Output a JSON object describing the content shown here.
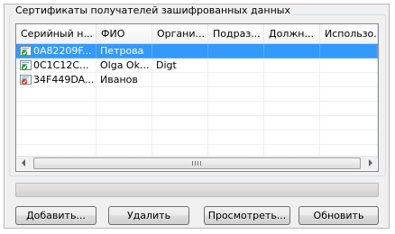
{
  "group": {
    "title": "Сертификаты получателей зашифрованных данных"
  },
  "table": {
    "columns": [
      "Серийный н...",
      "ФИО",
      "Органи...",
      "Подраз...",
      "Должн...",
      "Использо..."
    ],
    "rows": [
      {
        "serial": "0A82209F...",
        "name": "Петрова",
        "org": "",
        "dept": "",
        "position": "",
        "usage": "",
        "icon": "certificate-valid-icon",
        "selected": true
      },
      {
        "serial": "0C1C12C...",
        "name": "Olga Ok...",
        "org": "Digt",
        "dept": "",
        "position": "",
        "usage": "",
        "icon": "certificate-valid-icon",
        "selected": false
      },
      {
        "serial": "34F449DA...",
        "name": "Иванов",
        "org": "",
        "dept": "",
        "position": "",
        "usage": "",
        "icon": "certificate-warning-icon",
        "selected": false
      }
    ]
  },
  "buttons": {
    "add": "Добавить...",
    "delete": "Удалить",
    "view": "Просмотреть...",
    "refresh": "Обновить"
  },
  "colors": {
    "selection": "#3399ff",
    "cert_green": "#2e9d3a",
    "cert_red": "#d23a2a"
  }
}
